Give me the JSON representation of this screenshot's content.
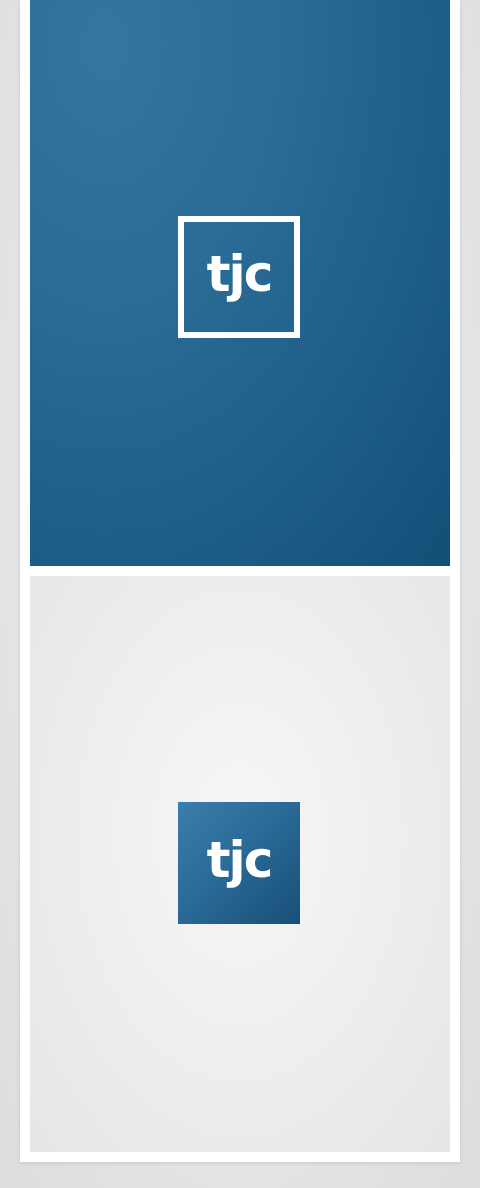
{
  "logo": {
    "text": "tjc"
  },
  "colors": {
    "brand_blue": "#1f5f89",
    "brand_blue_light": "#3476a0",
    "brand_blue_dark": "#134f77",
    "frame_white": "#ffffff",
    "paper_gray": "#ededed"
  }
}
